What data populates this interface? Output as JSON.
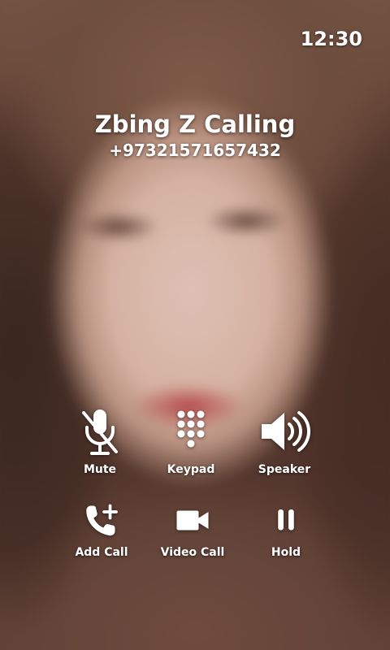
{
  "status_bar": {
    "time": "12:30"
  },
  "caller": {
    "title": "Zbing Z Calling",
    "number": "+97321571657432"
  },
  "controls": [
    {
      "label": "Mute",
      "icon": "muted-microphone-icon"
    },
    {
      "label": "Keypad",
      "icon": "keypad-icon"
    },
    {
      "label": "Speaker",
      "icon": "speaker-icon"
    },
    {
      "label": "Add Call",
      "icon": "add-call-icon"
    },
    {
      "label": "Video Call",
      "icon": "video-camera-icon"
    },
    {
      "label": "Hold",
      "icon": "pause-icon"
    }
  ],
  "colors": {
    "text": "#ffffff"
  }
}
